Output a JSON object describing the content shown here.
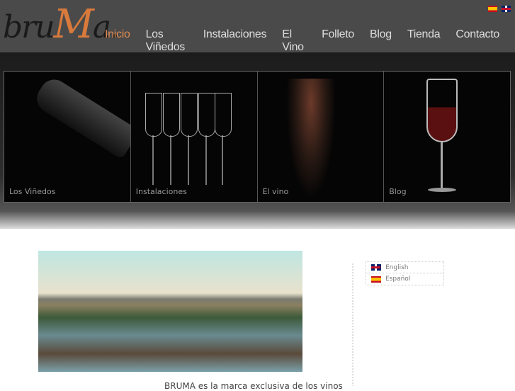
{
  "logo": {
    "text_a": "bru",
    "text_b": "M",
    "text_c": "a."
  },
  "nav": [
    "Inicio",
    "Los Viñedos",
    "Instalaciones",
    "El Vino",
    "Folleto",
    "Blog",
    "Tienda",
    "Contacto"
  ],
  "tiles": [
    "Los Viñedos",
    "Instalaciones",
    "El vino",
    "Blog"
  ],
  "languages": [
    "English",
    "Español"
  ],
  "intro": "BRUMA es la marca exclusiva de los vinos"
}
